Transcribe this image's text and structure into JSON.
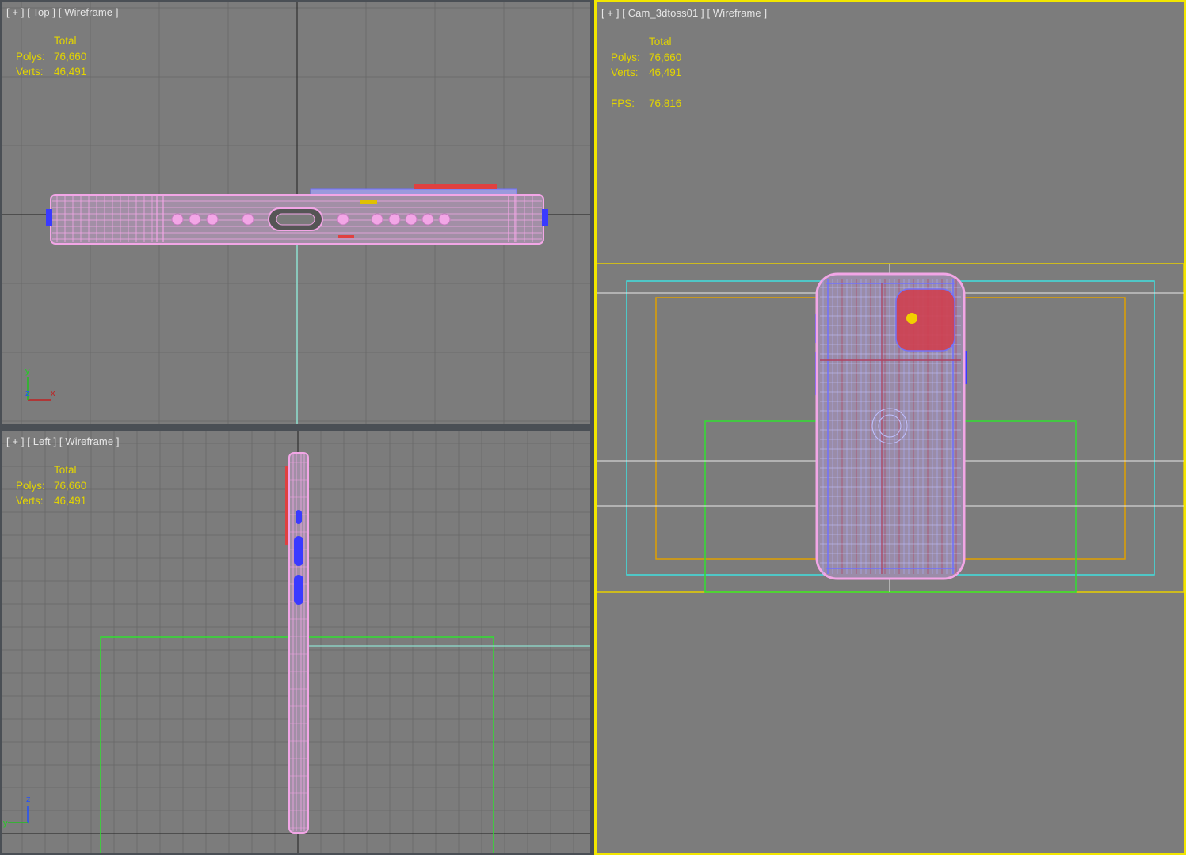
{
  "viewports": {
    "top": {
      "label": {
        "plus": "[ + ]",
        "view": "[ Top ]",
        "mode": "[ Wireframe ]"
      },
      "stats": {
        "header": "Total",
        "polys_label": "Polys:",
        "polys": "76,660",
        "verts_label": "Verts:",
        "verts": "46,491"
      },
      "axis": {
        "a": "y",
        "b": "z",
        "c": "x"
      }
    },
    "left": {
      "label": {
        "plus": "[ + ]",
        "view": "[ Left ]",
        "mode": "[ Wireframe ]"
      },
      "stats": {
        "header": "Total",
        "polys_label": "Polys:",
        "polys": "76,660",
        "verts_label": "Verts:",
        "verts": "46,491"
      },
      "axis": {
        "a": "z",
        "b": "y"
      }
    },
    "camera": {
      "label": {
        "plus": "[ + ]",
        "view": "[ Cam_3dtoss01 ]",
        "mode": "[ Wireframe ]"
      },
      "stats": {
        "header": "Total",
        "polys_label": "Polys:",
        "polys": "76,660",
        "verts_label": "Verts:",
        "verts": "46,491",
        "fps_label": "FPS:",
        "fps": "76.816"
      }
    }
  },
  "colors": {
    "viewport_bg": "#7c7c7c",
    "grid": "#6a6a6a",
    "active_border": "#f2e600",
    "stats_text": "#e3d400",
    "wire_pink": "#f2a6e6",
    "wire_blue": "#6a6aff",
    "wire_red": "#e03030",
    "safe_frame_yellow": "#e8d000",
    "safe_frame_cyan": "#40e0e0",
    "safe_frame_orange": "#e0a000",
    "safe_frame_green": "#30e030"
  }
}
